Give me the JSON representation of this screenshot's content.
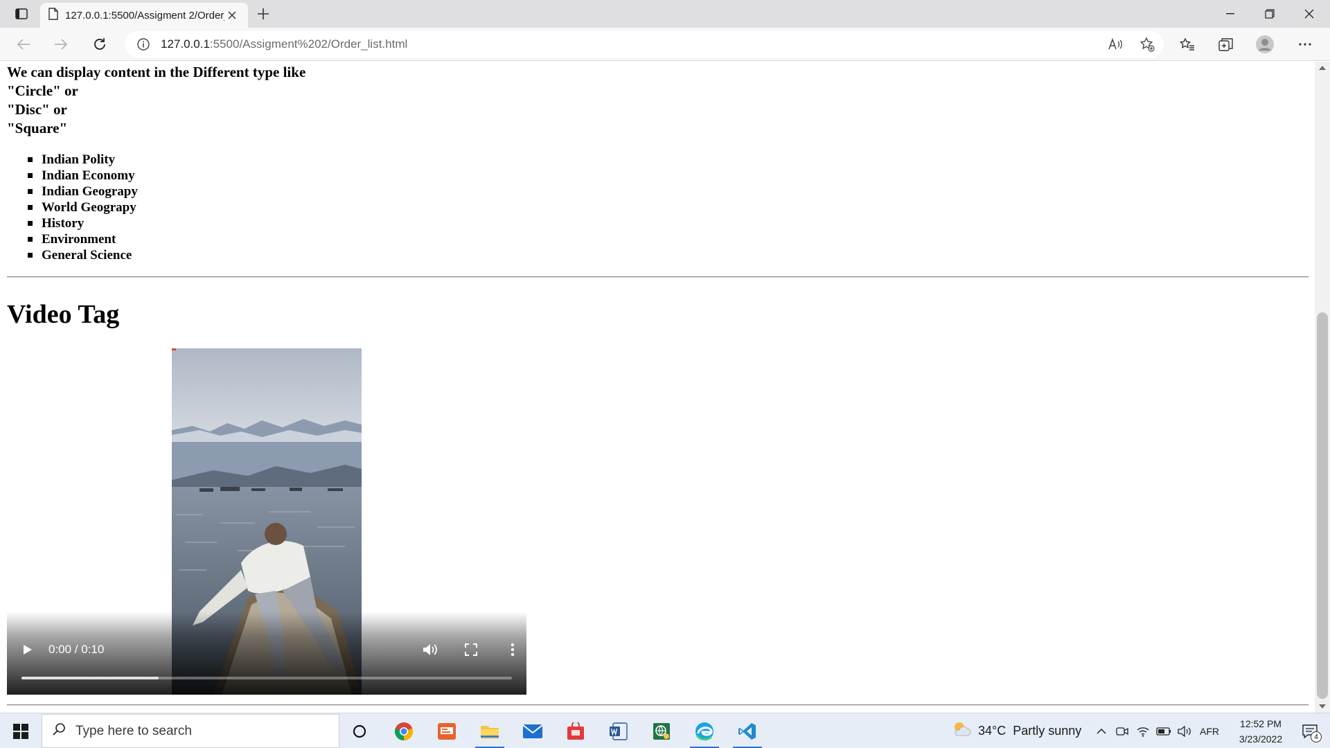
{
  "browser": {
    "tab": {
      "title": "127.0.0.1:5500/Assigment 2/Order_list.html",
      "icon": "page-icon"
    },
    "address": {
      "host": "127.0.0.1",
      "path": ":5500/Assigment%202/Order_list.html"
    }
  },
  "page": {
    "intro_lines": [
      "We can display content in the Different type like",
      "\"Circle\" or",
      "\"Disc\" or",
      "\"Square\""
    ],
    "topics": [
      "Indian Polity",
      "Indian Economy",
      "Indian Geograpy",
      "World Geograpy",
      "History",
      "Environment",
      "General Science"
    ],
    "video_heading": "Video Tag",
    "video": {
      "timecode": "0:00 / 0:10",
      "buffered_fraction": 0.28
    }
  },
  "taskbar": {
    "search_placeholder": "Type here to search",
    "weather": {
      "temp": "34°C",
      "desc": "Partly sunny"
    },
    "language": "AFR",
    "time": "12:52 PM",
    "date": "3/23/2022",
    "notification_count": "4"
  },
  "colors": {
    "accent": "#2f6fd1",
    "chrome_bg": "#dfdfe1",
    "toolbar_bg": "#f7f7f7",
    "taskbar_bg": "#e6edf6"
  }
}
